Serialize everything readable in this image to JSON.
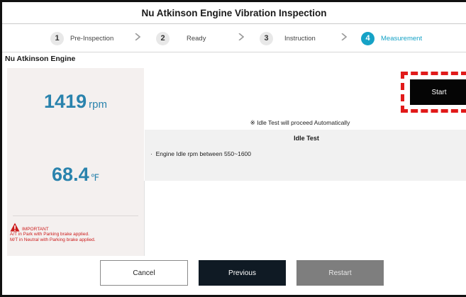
{
  "window": {
    "title": "Nu Atkinson Engine Vibration Inspection"
  },
  "stepper": {
    "steps": [
      {
        "num": "1",
        "label": "Pre-Inspection",
        "active": false
      },
      {
        "num": "2",
        "label": "Ready",
        "active": false
      },
      {
        "num": "3",
        "label": "Instruction",
        "active": false
      },
      {
        "num": "4",
        "label": "Measurement",
        "active": true
      }
    ],
    "active_color": "#15a2c6"
  },
  "section": {
    "title": "Nu Atkinson Engine"
  },
  "readings": {
    "rpm": {
      "value": "1419",
      "unit": "rpm"
    },
    "temp": {
      "value": "68.4",
      "unit": "℉"
    }
  },
  "important": {
    "heading": "IMPORTANT",
    "lines": [
      "A/T in Park with Parking brake applied.",
      "M/T in Neutral with Parking brake applied."
    ]
  },
  "start": {
    "label": "Start"
  },
  "auto_note": "※ Idle Test will proceed Automatically",
  "idle_test": {
    "title": "Idle Test",
    "items": [
      "Engine Idle rpm between 550~1600"
    ]
  },
  "buttons": {
    "cancel": "Cancel",
    "previous": "Previous",
    "restart": "Restart"
  },
  "colors": {
    "accent": "#15a2c6",
    "reading": "#2a83ad",
    "warning": "#cc1b1b",
    "highlight": "#e11a1a"
  }
}
